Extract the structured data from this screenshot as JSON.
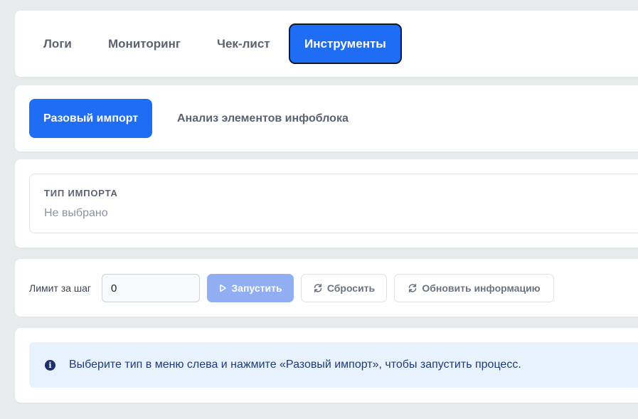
{
  "tabs": [
    {
      "label": "Логи",
      "active": false
    },
    {
      "label": "Мониторинг",
      "active": false
    },
    {
      "label": "Чек-лист",
      "active": false
    },
    {
      "label": "Инструменты",
      "active": true
    }
  ],
  "subtabs": [
    {
      "label": "Разовый импорт",
      "active": true
    },
    {
      "label": "Анализ элементов инфоблока",
      "active": false
    }
  ],
  "import_type": {
    "label": "Тип импорта",
    "value": "Не выбрано"
  },
  "controls": {
    "limit_label": "Лимит за шаг",
    "limit_value": "0",
    "run_label": "Запустить",
    "reset_label": "Сбросить",
    "refresh_label": "Обновить информацию",
    "run_icon": "play-icon",
    "reset_icon": "refresh-icon",
    "refresh_icon": "refresh-icon"
  },
  "info": {
    "icon": "info-icon",
    "text": "Выберите тип в меню слева и нажмите «Разовый импорт», чтобы запустить процесс."
  },
  "colors": {
    "accent": "#1f6df5",
    "accent_disabled": "#91aef2",
    "info_bg": "#e8f2fd",
    "info_text": "#1e3a7a"
  }
}
